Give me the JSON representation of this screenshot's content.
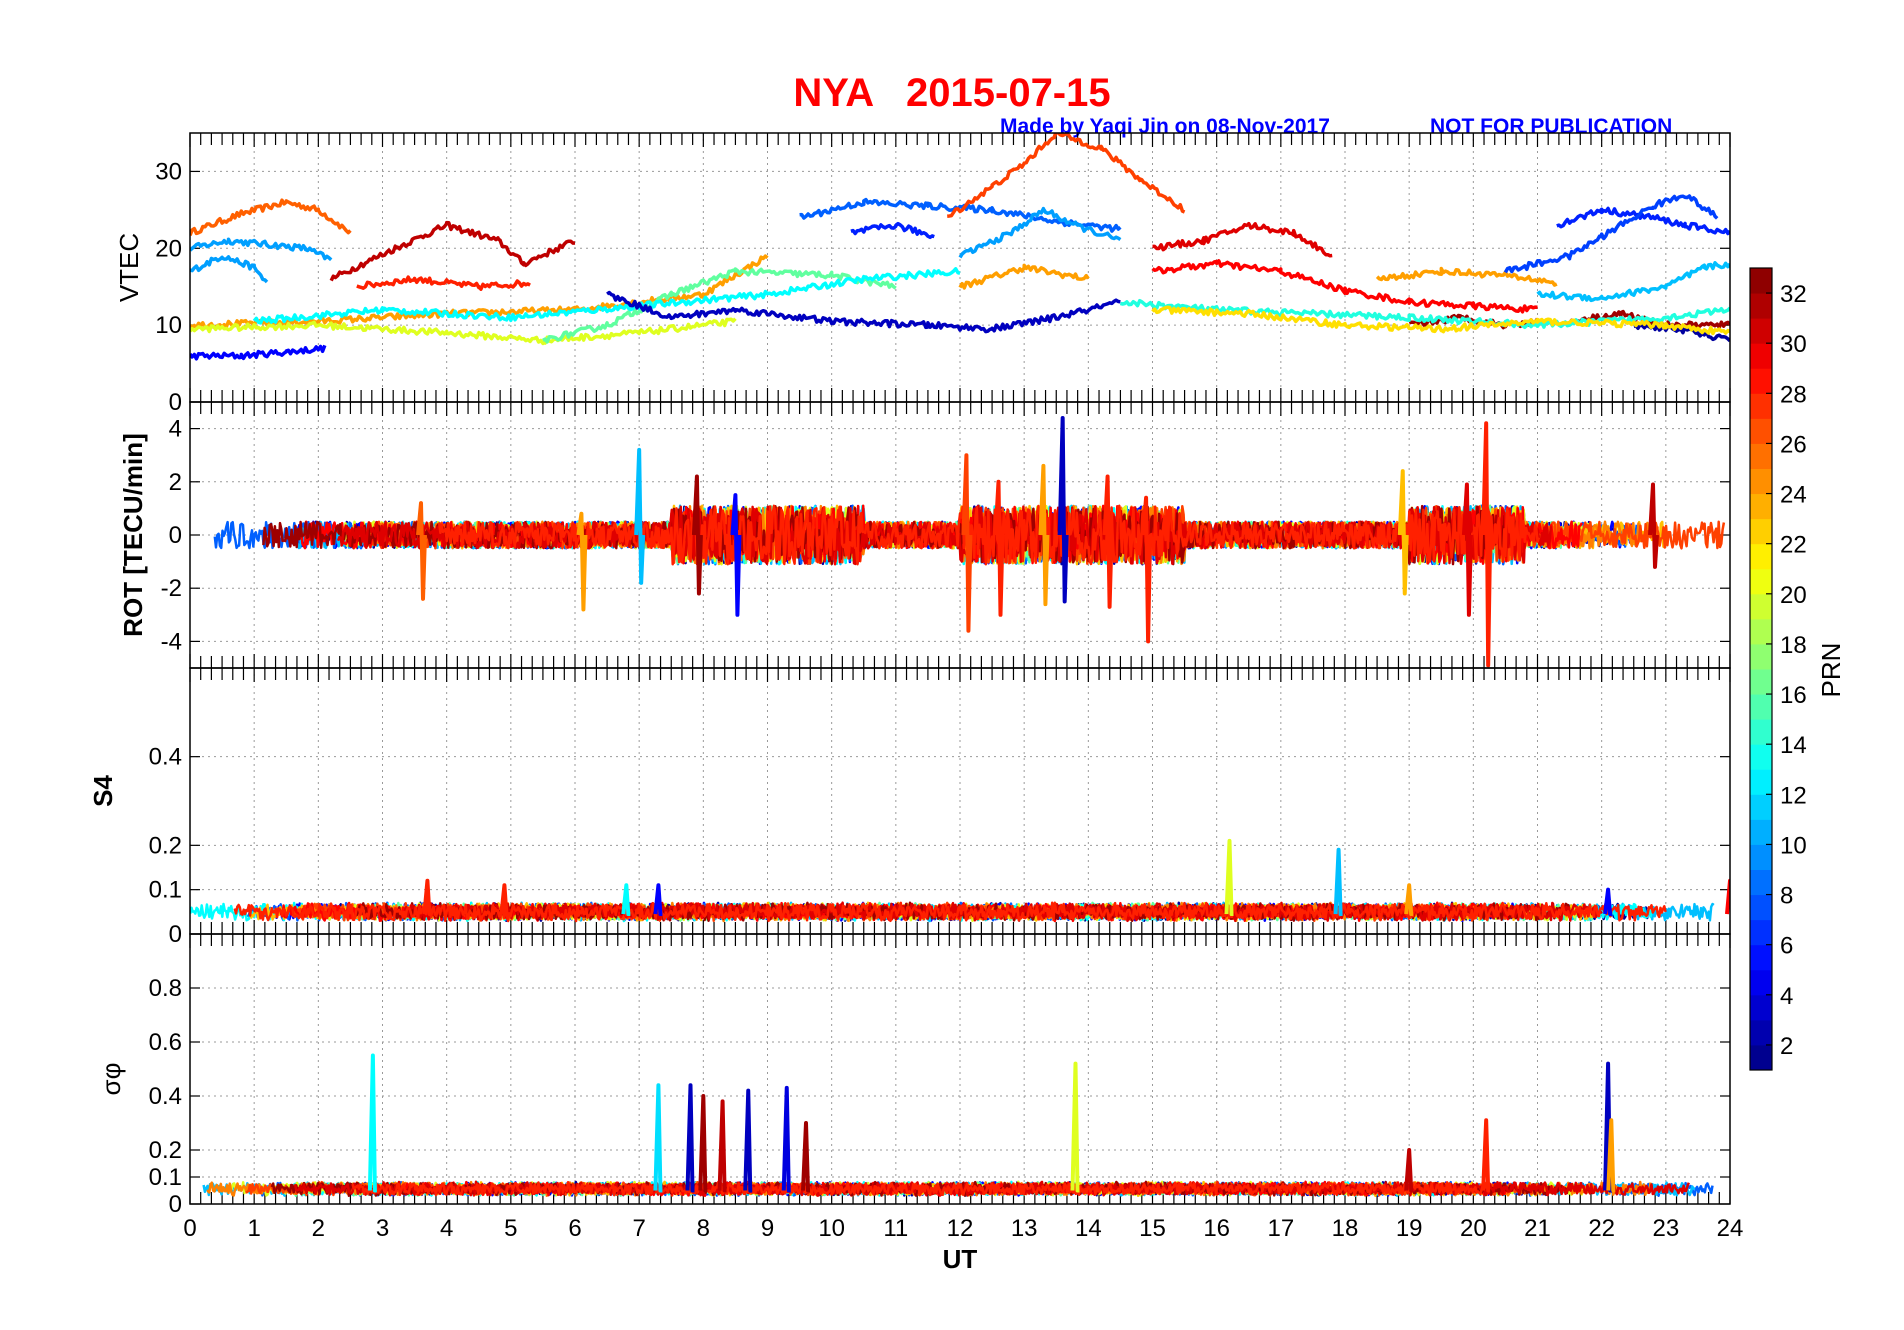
{
  "figure": {
    "title": "NYA   2015-07-15",
    "credit": "Made by Yaqi Jin on 08-Nov-2017",
    "notice": "NOT FOR PUBLICATION",
    "title_color": "#ff0000",
    "credit_color": "#0000ff"
  },
  "colorbar": {
    "label": "PRN",
    "min": 1,
    "max": 33,
    "colormap": "jet",
    "ticks": [
      "2",
      "4",
      "6",
      "8",
      "10",
      "12",
      "14",
      "16",
      "18",
      "20",
      "22",
      "24",
      "26",
      "28",
      "30",
      "32"
    ]
  },
  "chart_data": [
    {
      "type": "line",
      "panel": "vtec",
      "ylabel": "VTEC",
      "xlim": [
        0,
        24
      ],
      "ylim": [
        0,
        35
      ],
      "yticks": [
        "0",
        "10",
        "20",
        "30"
      ],
      "grid": true,
      "series_note_unused": null,
      "series": [
        {
          "prn": 26,
          "segments": [
            [
              [
                0,
                22
              ],
              [
                0.8,
                24.5
              ],
              [
                1.5,
                26
              ],
              [
                2.0,
                25
              ],
              [
                2.5,
                22
              ]
            ]
          ]
        },
        {
          "prn": 10,
          "segments": [
            [
              [
                0,
                20
              ],
              [
                0.6,
                21
              ],
              [
                1.2,
                20.5
              ],
              [
                1.8,
                20
              ],
              [
                2.2,
                18.5
              ]
            ],
            [
              [
                0,
                17
              ],
              [
                0.5,
                19
              ],
              [
                1.0,
                17.5
              ],
              [
                1.2,
                15.5
              ]
            ]
          ]
        },
        {
          "prn": 5,
          "segments": [
            [
              [
                0,
                6
              ],
              [
                0.8,
                6
              ],
              [
                1.5,
                6.5
              ],
              [
                2.1,
                7
              ]
            ]
          ]
        },
        {
          "prn": 31,
          "segments": [
            [
              [
                2.2,
                16
              ],
              [
                3.2,
                20
              ],
              [
                4.0,
                23
              ],
              [
                4.8,
                21
              ],
              [
                5.2,
                18
              ],
              [
                6.0,
                21
              ]
            ]
          ]
        },
        {
          "prn": 28,
          "segments": [
            [
              [
                2.6,
                15
              ],
              [
                3.5,
                16
              ],
              [
                4.5,
                15
              ],
              [
                5.3,
                15.5
              ]
            ]
          ]
        },
        {
          "prn": 24,
          "segments": [
            [
              [
                0,
                10
              ],
              [
                2,
                10.5
              ],
              [
                4,
                11.5
              ],
              [
                6,
                12
              ],
              [
                8,
                14
              ],
              [
                9,
                19
              ]
            ],
            [
              [
                12,
                15
              ],
              [
                13,
                17.5
              ],
              [
                14,
                16
              ]
            ]
          ]
        },
        {
          "prn": 20,
          "segments": [
            [
              [
                0,
                9.5
              ],
              [
                2,
                10
              ],
              [
                4,
                9
              ],
              [
                5.5,
                8
              ],
              [
                7,
                9
              ],
              [
                8.5,
                10.5
              ]
            ]
          ]
        },
        {
          "prn": 16,
          "segments": [
            [
              [
                5.5,
                8
              ],
              [
                6.5,
                10
              ],
              [
                7.5,
                14
              ],
              [
                8.5,
                17
              ],
              [
                10,
                16.5
              ],
              [
                11,
                15
              ]
            ]
          ]
        },
        {
          "prn": 13,
          "segments": [
            [
              [
                1,
                10.5
              ],
              [
                3,
                12
              ],
              [
                5,
                11
              ],
              [
                7,
                12.5
              ],
              [
                9,
                14
              ],
              [
                10.5,
                16
              ],
              [
                12,
                17
              ]
            ]
          ]
        },
        {
          "prn": 8,
          "segments": [
            [
              [
                9.5,
                24
              ],
              [
                10.5,
                26
              ],
              [
                11.5,
                25.5
              ],
              [
                12.5,
                25
              ],
              [
                13.5,
                23.5
              ],
              [
                14.5,
                22.5
              ]
            ]
          ]
        },
        {
          "prn": 10,
          "segments": [
            [
              [
                12,
                19
              ],
              [
                12.8,
                22
              ],
              [
                13.3,
                25
              ],
              [
                13.8,
                23
              ],
              [
                14.5,
                21
              ]
            ]
          ]
        },
        {
          "prn": 6,
          "segments": [
            [
              [
                10.3,
                22
              ],
              [
                11,
                23
              ],
              [
                11.6,
                21.5
              ]
            ],
            [
              [
                21.3,
                23
              ],
              [
                22,
                25
              ],
              [
                22.8,
                24
              ],
              [
                23.3,
                23
              ],
              [
                24,
                22
              ]
            ]
          ]
        },
        {
          "prn": 27,
          "segments": [
            [
              [
                11.8,
                24
              ],
              [
                12.5,
                28
              ],
              [
                13,
                31
              ],
              [
                13.5,
                35
              ],
              [
                14.2,
                33
              ],
              [
                14.8,
                29
              ],
              [
                15.5,
                25
              ]
            ]
          ]
        },
        {
          "prn": 30,
          "segments": [
            [
              [
                15.0,
                20
              ],
              [
                15.8,
                21
              ],
              [
                16.5,
                23
              ],
              [
                17.2,
                22
              ],
              [
                17.8,
                19
              ]
            ]
          ]
        },
        {
          "prn": 29,
          "segments": [
            [
              [
                15.0,
                17
              ],
              [
                16,
                18
              ],
              [
                17,
                17
              ],
              [
                18,
                14.5
              ],
              [
                19,
                13
              ],
              [
                20,
                12.5
              ],
              [
                21,
                12
              ]
            ]
          ]
        },
        {
          "prn": 24,
          "segments": [
            [
              [
                18.5,
                16
              ],
              [
                19.5,
                17
              ],
              [
                20.5,
                16.5
              ],
              [
                21.3,
                15.5
              ]
            ]
          ]
        },
        {
          "prn": 7,
          "segments": [
            [
              [
                20.5,
                17
              ],
              [
                21.5,
                19
              ],
              [
                22,
                21.5
              ],
              [
                22.8,
                25.5
              ],
              [
                23.3,
                27
              ],
              [
                23.8,
                24
              ]
            ]
          ]
        },
        {
          "prn": 11,
          "segments": [
            [
              [
                21,
                14
              ],
              [
                22,
                13.5
              ],
              [
                23,
                15
              ],
              [
                23.6,
                17.5
              ],
              [
                24,
                18
              ]
            ]
          ]
        },
        {
          "prn": 3,
          "segments": [
            [
              [
                6.5,
                14
              ],
              [
                7.5,
                11
              ],
              [
                8.5,
                12
              ],
              [
                10,
                10.5
              ],
              [
                11.5,
                10
              ],
              [
                12.5,
                9.5
              ],
              [
                13.5,
                11
              ],
              [
                14.5,
                13
              ]
            ]
          ]
        },
        {
          "prn": 32,
          "segments": [
            [
              [
                19,
                10
              ],
              [
                19.8,
                11
              ],
              [
                20.5,
                10
              ],
              [
                21,
                10.5
              ]
            ],
            [
              [
                21.5,
                10.5
              ],
              [
                22.3,
                11.5
              ],
              [
                23,
                10
              ],
              [
                24,
                10
              ]
            ]
          ]
        },
        {
          "prn": 2,
          "segments": [
            [
              [
                22.5,
                10
              ],
              [
                23.2,
                9.5
              ],
              [
                24,
                8
              ]
            ]
          ]
        },
        {
          "prn": 14,
          "segments": [
            [
              [
                14.5,
                13
              ],
              [
                16,
                12
              ],
              [
                17.5,
                11.5
              ],
              [
                19,
                11
              ],
              [
                21,
                10
              ],
              [
                23,
                11
              ],
              [
                24,
                12
              ]
            ]
          ]
        },
        {
          "prn": 22,
          "segments": [
            [
              [
                15,
                12
              ],
              [
                16.5,
                11.5
              ],
              [
                18,
                10
              ],
              [
                19.5,
                9.5
              ],
              [
                21,
                10.5
              ],
              [
                23,
                10
              ],
              [
                24,
                9
              ]
            ]
          ]
        }
      ]
    },
    {
      "type": "line",
      "panel": "rot",
      "ylabel": "ROT [TECU/min]",
      "xlim": [
        0,
        24
      ],
      "ylim": [
        -5,
        5
      ],
      "yticks": [
        "-4",
        "-2",
        "0",
        "2",
        "4"
      ],
      "grid": true,
      "spikes": [
        {
          "prn": 11,
          "x": 7.0,
          "max": 3.2,
          "min": -1.8
        },
        {
          "prn": 32,
          "x": 7.9,
          "max": 2.2,
          "min": -2.2
        },
        {
          "prn": 5,
          "x": 8.5,
          "max": 1.5,
          "min": -3.0
        },
        {
          "prn": 26,
          "x": 3.6,
          "max": 1.2,
          "min": -2.4
        },
        {
          "prn": 24,
          "x": 6.1,
          "max": 0.8,
          "min": -2.8
        },
        {
          "prn": 27,
          "x": 12.1,
          "max": 3.0,
          "min": -3.6
        },
        {
          "prn": 28,
          "x": 12.6,
          "max": 2.0,
          "min": -3.0
        },
        {
          "prn": 3,
          "x": 13.6,
          "max": 4.4,
          "min": -2.5
        },
        {
          "prn": 24,
          "x": 13.3,
          "max": 2.6,
          "min": -2.6
        },
        {
          "prn": 28,
          "x": 14.3,
          "max": 2.2,
          "min": -2.7
        },
        {
          "prn": 28,
          "x": 14.9,
          "max": 1.4,
          "min": -4.0
        },
        {
          "prn": 28,
          "x": 20.2,
          "max": 4.2,
          "min": -4.9
        },
        {
          "prn": 30,
          "x": 19.9,
          "max": 1.9,
          "min": -3.0
        },
        {
          "prn": 23,
          "x": 18.9,
          "max": 2.4,
          "min": -2.2
        },
        {
          "prn": 31,
          "x": 22.8,
          "max": 1.9,
          "min": -1.2
        }
      ]
    },
    {
      "type": "line",
      "panel": "s4",
      "ylabel": "S4",
      "xlim": [
        0,
        24
      ],
      "ylim": [
        0,
        0.6
      ],
      "yticks": [
        "0",
        "0.1",
        "0.2",
        "0.4"
      ],
      "grid": true,
      "spikes": [
        {
          "prn": 20,
          "x": 16.2,
          "max": 0.21
        },
        {
          "prn": 11,
          "x": 17.9,
          "max": 0.19
        },
        {
          "prn": 28,
          "x": 3.7,
          "max": 0.12
        },
        {
          "prn": 5,
          "x": 7.3,
          "max": 0.11
        },
        {
          "prn": 13,
          "x": 6.8,
          "max": 0.11
        },
        {
          "prn": 24,
          "x": 19.0,
          "max": 0.11
        },
        {
          "prn": 29,
          "x": 24.0,
          "max": 0.12
        },
        {
          "prn": 5,
          "x": 22.1,
          "max": 0.1
        },
        {
          "prn": 28,
          "x": 4.9,
          "max": 0.11
        }
      ]
    },
    {
      "type": "line",
      "panel": "sigma_phi",
      "ylabel": "σφ",
      "xlabel": "UT",
      "xlim": [
        0,
        24
      ],
      "ylim": [
        0,
        1
      ],
      "yticks": [
        "0",
        "0.1",
        "0.2",
        "0.4",
        "0.6",
        "0.8"
      ],
      "xticks": [
        "0",
        "1",
        "2",
        "3",
        "4",
        "5",
        "6",
        "7",
        "8",
        "9",
        "10",
        "11",
        "12",
        "13",
        "14",
        "15",
        "16",
        "17",
        "18",
        "19",
        "20",
        "21",
        "22",
        "23",
        "24"
      ],
      "grid": true,
      "spikes": [
        {
          "prn": 13,
          "x": 2.85,
          "max": 0.55
        },
        {
          "prn": 12,
          "x": 7.3,
          "max": 0.44
        },
        {
          "prn": 3,
          "x": 7.8,
          "max": 0.44
        },
        {
          "prn": 32,
          "x": 8.0,
          "max": 0.4
        },
        {
          "prn": 31,
          "x": 8.3,
          "max": 0.38
        },
        {
          "prn": 3,
          "x": 8.7,
          "max": 0.42
        },
        {
          "prn": 4,
          "x": 9.3,
          "max": 0.43
        },
        {
          "prn": 32,
          "x": 9.6,
          "max": 0.3
        },
        {
          "prn": 20,
          "x": 13.8,
          "max": 0.52
        },
        {
          "prn": 28,
          "x": 20.2,
          "max": 0.31
        },
        {
          "prn": 3,
          "x": 22.1,
          "max": 0.52
        },
        {
          "prn": 24,
          "x": 22.15,
          "max": 0.31
        },
        {
          "prn": 31,
          "x": 19.0,
          "max": 0.2
        }
      ]
    }
  ]
}
